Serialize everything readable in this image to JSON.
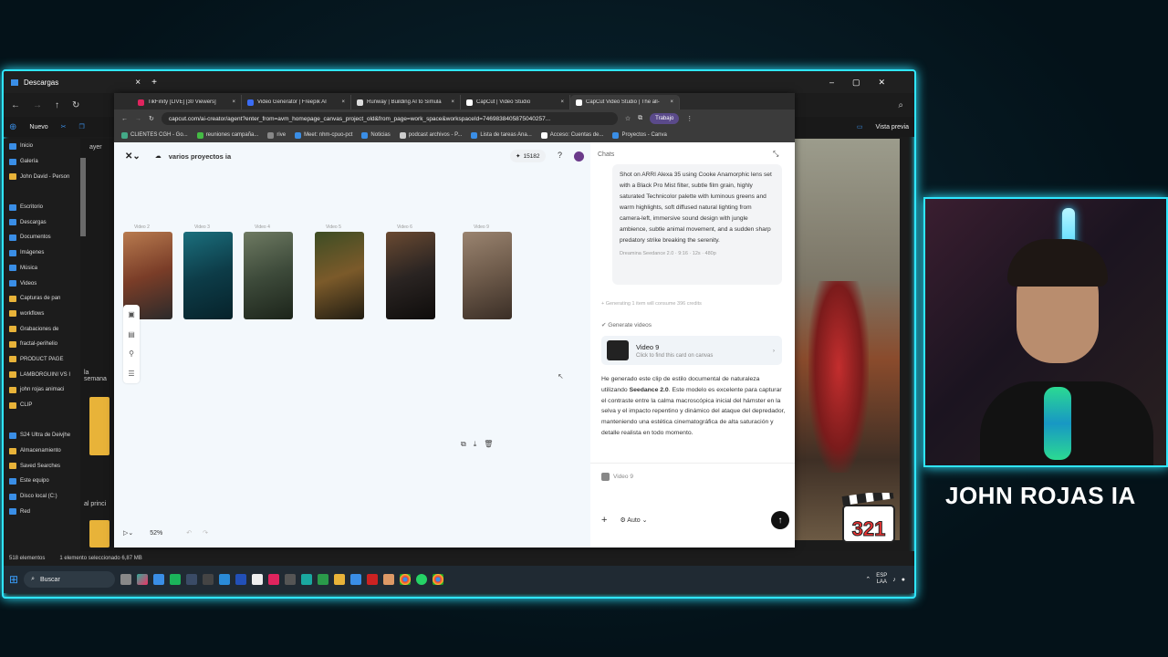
{
  "explorer": {
    "title": "Descargas",
    "new_label": "Nuevo",
    "preview_label": "Vista previa",
    "group_label_1": "ayer",
    "group_label_2": "la semana",
    "group_label_3": "al princi",
    "status_count": "518 elementos",
    "status_selected": "1 elemento seleccionado 6,87 MB",
    "sidebar": [
      {
        "label": "Inicio",
        "kind": "home"
      },
      {
        "label": "Galería",
        "kind": "blue"
      },
      {
        "label": "John David - Person",
        "kind": "folder"
      },
      {
        "label": "",
        "kind": "spacer"
      },
      {
        "label": "Escritorio",
        "kind": "blue"
      },
      {
        "label": "Descargas",
        "kind": "blue"
      },
      {
        "label": "Documentos",
        "kind": "blue"
      },
      {
        "label": "Imágenes",
        "kind": "blue"
      },
      {
        "label": "Música",
        "kind": "blue"
      },
      {
        "label": "Videos",
        "kind": "blue"
      },
      {
        "label": "Capturas de pan",
        "kind": "folder"
      },
      {
        "label": "workflows",
        "kind": "folder"
      },
      {
        "label": "Grabaciones de",
        "kind": "folder"
      },
      {
        "label": "fractal-perihelio",
        "kind": "folder"
      },
      {
        "label": "PRODUCT PAGE",
        "kind": "folder"
      },
      {
        "label": "LAMBORGUINI VS I",
        "kind": "folder"
      },
      {
        "label": "john rojas animaci",
        "kind": "folder"
      },
      {
        "label": "CLIP",
        "kind": "folder"
      },
      {
        "label": "",
        "kind": "spacer"
      },
      {
        "label": "S24 Ultra de Deivjhe",
        "kind": "blue"
      },
      {
        "label": "Almacenamiento",
        "kind": "folder"
      },
      {
        "label": "Saved Searches",
        "kind": "folder"
      },
      {
        "label": "Este equipo",
        "kind": "blue"
      },
      {
        "label": "Disco local (C:)",
        "kind": "blue"
      },
      {
        "label": "Red",
        "kind": "blue"
      }
    ]
  },
  "taskbar": {
    "search_label": "Buscar",
    "lang": "ESP",
    "lang2": "LAA"
  },
  "browser": {
    "tabs": [
      {
        "label": "TikFinity [LIVE] [30 Viewers]",
        "color": "#e0245e"
      },
      {
        "label": "Video Generator | Freepik AI",
        "color": "#3a6cf4"
      },
      {
        "label": "Runway | Building AI to Simula",
        "color": "#dddddd"
      },
      {
        "label": "CapCut | Video Studio",
        "color": "#ffffff"
      },
      {
        "label": "CapCut Video Studio | The all-",
        "color": "#ffffff"
      }
    ],
    "url": "capcut.com/ai-creator/agent?enter_from=avm_homepage_canvas_project_old&from_page=work_space&workspaceId=7469838405875040257...",
    "profile": "Trabajo",
    "bookmarks": [
      "CLIENTES CGH - Go...",
      "reuniones campaña...",
      "rive",
      "Meet: nhm-cpuo-pct",
      "Noticias",
      "podcast archivos - P...",
      "Lista de tareas Ana...",
      "Acceso: Cuentas de...",
      "Proyectos - Canva"
    ]
  },
  "capcut": {
    "project_name": "varios proyectos ia",
    "credits": "15182",
    "zoom": "52%",
    "clips": [
      {
        "label": "Video 2",
        "colors": [
          "#7a3d28",
          "#b87b4f",
          "#2b2a2a"
        ]
      },
      {
        "label": "Video 3",
        "colors": [
          "#0d3c48",
          "#1b6f7d",
          "#06222a"
        ]
      },
      {
        "label": "Video 4",
        "colors": [
          "#3d4a3a",
          "#6e7a62",
          "#1c241a"
        ]
      },
      {
        "label": "Video 5",
        "colors": [
          "#7b5a2a",
          "#3d4d24",
          "#201c12"
        ]
      },
      {
        "label": "Video 6",
        "colors": [
          "#2a2422",
          "#6a4a32",
          "#0e0c0b"
        ]
      },
      {
        "label": "Video 9",
        "colors": [
          "#6d5a4a",
          "#9a8470",
          "#3a2e26"
        ]
      }
    ]
  },
  "chat": {
    "title": "Chats",
    "prompt_text": "Shot on ARRI Alexa 35 using Cooke Anamorphic lens set with a Black Pro Mist filter, subtle film grain, highly saturated Technicolor palette with luminous greens and warm highlights, soft diffused natural lighting from camera-left, immersive sound design with jungle ambience, subtle animal movement, and a sudden sharp predatory strike breaking the serenity.",
    "prompt_meta": "Dreamina Seedance 2.0 · 9:16 · 12s · 480p",
    "generating_note": "Generating 1 item will consume 396 credits",
    "generate_label": "Generate videos",
    "card_title": "Video 9",
    "card_sub": "Click to find this card on canvas",
    "msg_part1": "He generado este clip de estilo documental de naturaleza utilizando ",
    "msg_bold": "Seedance 2.0",
    "msg_part2": ". Este modelo es excelente para capturar el contraste entre la calma macroscópica inicial del hámster en la selva y el impacto repentino y dinámico del ataque del depredador, manteniendo una estética cinematográfica de alta saturación y detalle realista en todo momento.",
    "ref_label": "Video 9",
    "mode": "Auto"
  },
  "overlay": {
    "channel_name": "JOHN ROJAS IA",
    "accent": "#2fe6ff"
  }
}
